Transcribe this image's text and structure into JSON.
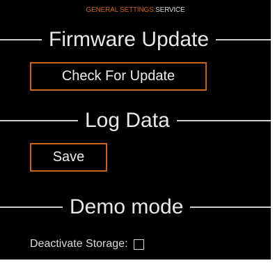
{
  "breadcrumb": {
    "section": "GENERAL SETTINGS:",
    "page": "SERVICE"
  },
  "firmware": {
    "title": "Firmware Update",
    "check_button": "Check For Update"
  },
  "log": {
    "title": "Log Data",
    "save_button": "Save"
  },
  "demo": {
    "title": "Demo mode",
    "deactivate_storage_label": "Deactivate Storage:",
    "deactivate_storage_checked": false
  },
  "colors": {
    "accent": "#c9621c",
    "background": "#000000",
    "text": "#e6e6e6"
  }
}
